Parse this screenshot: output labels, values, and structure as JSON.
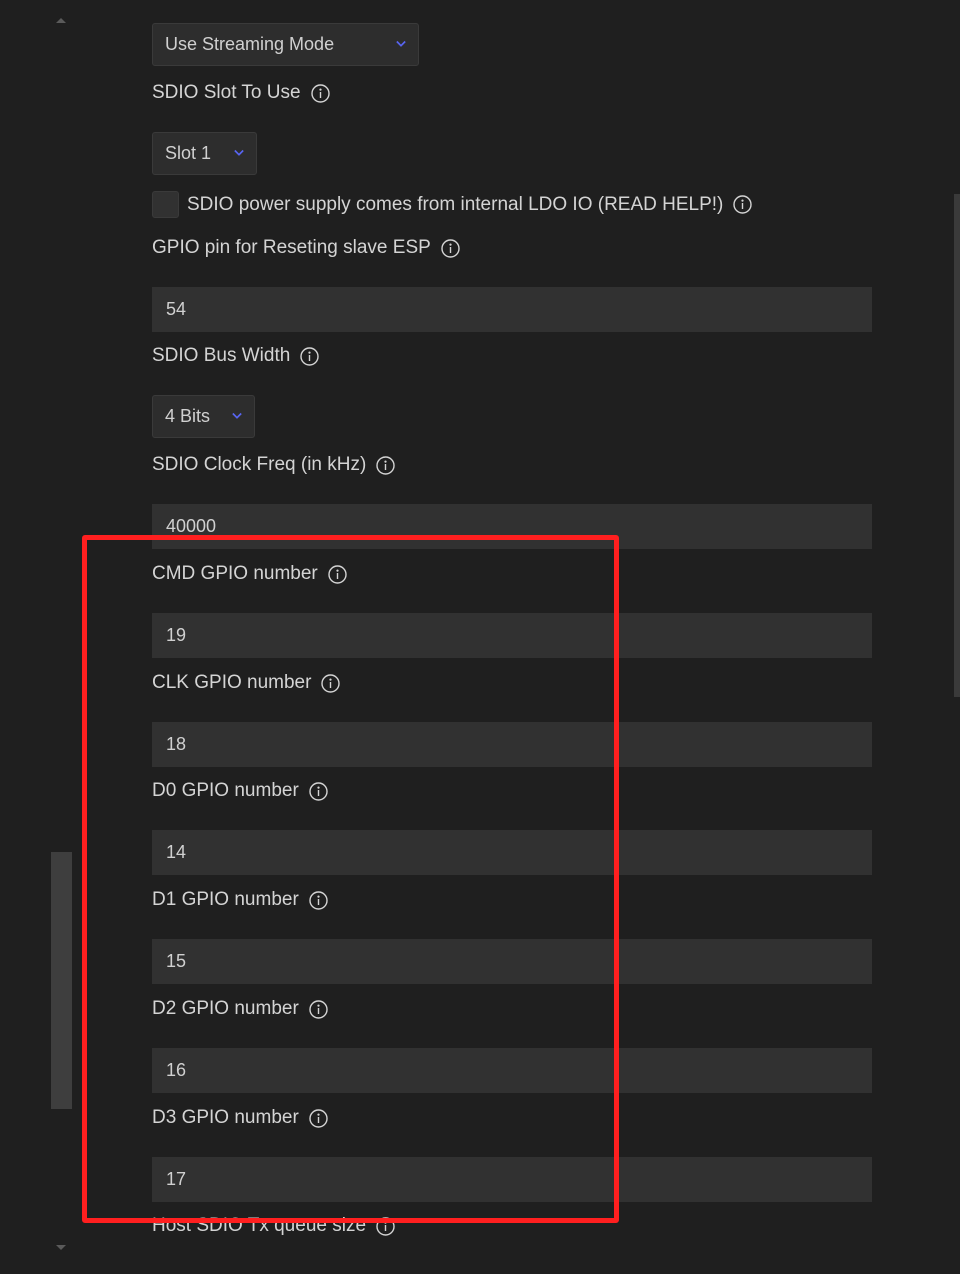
{
  "accent_color": "#5865f2",
  "highlight_color": "#ff1f1f",
  "streaming_mode": {
    "value": "Use Streaming Mode",
    "icon": "chevron-down-icon"
  },
  "sdio_slot": {
    "label": "SDIO Slot To Use",
    "value": "Slot 1",
    "info_icon": "info-icon"
  },
  "ldo_checkbox": {
    "label": "SDIO power supply comes from internal LDO IO (READ HELP!)",
    "checked": false
  },
  "reset_gpio": {
    "label": "GPIO pin for Reseting slave ESP",
    "value": "54"
  },
  "bus_width": {
    "label": "SDIO Bus Width",
    "value": "4 Bits"
  },
  "clock_freq": {
    "label": "SDIO Clock Freq (in kHz)",
    "value": "40000"
  },
  "cmd_gpio": {
    "label": "CMD GPIO number",
    "value": "19"
  },
  "clk_gpio": {
    "label": "CLK GPIO number",
    "value": "18"
  },
  "d0_gpio": {
    "label": "D0 GPIO number",
    "value": "14"
  },
  "d1_gpio": {
    "label": "D1 GPIO number",
    "value": "15"
  },
  "d2_gpio": {
    "label": "D2 GPIO number",
    "value": "16"
  },
  "d3_gpio": {
    "label": "D3 GPIO number",
    "value": "17"
  },
  "tx_queue": {
    "label": "Host SDIO Tx queue size"
  }
}
